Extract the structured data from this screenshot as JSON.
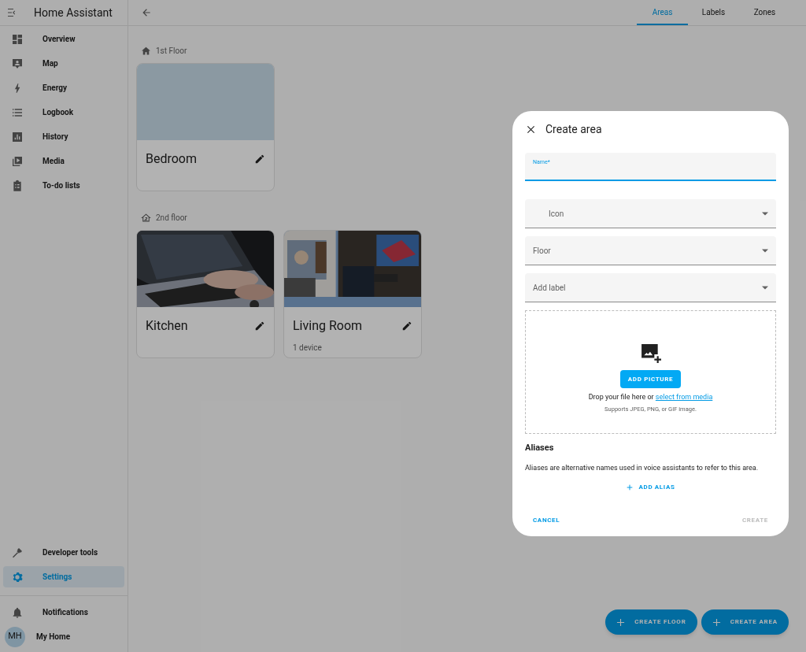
{
  "sidebar": {
    "title": "Home Assistant",
    "items": [
      {
        "label": "Overview",
        "kind": "dashboard",
        "selected": false
      },
      {
        "label": "Map",
        "kind": "map",
        "selected": false
      },
      {
        "label": "Energy",
        "kind": "bolt",
        "selected": false
      },
      {
        "label": "Logbook",
        "kind": "list",
        "selected": false
      },
      {
        "label": "History",
        "kind": "chart",
        "selected": false
      },
      {
        "label": "Media",
        "kind": "play",
        "selected": false
      },
      {
        "label": "To-do lists",
        "kind": "clipboard",
        "selected": false
      }
    ],
    "bottom_items": [
      {
        "label": "Developer tools",
        "kind": "hammer",
        "selected": false
      },
      {
        "label": "Settings",
        "kind": "gear",
        "selected": true
      }
    ],
    "notifications": "Notifications",
    "user": {
      "initials": "MH",
      "name": "My Home"
    }
  },
  "tabs": [
    {
      "label": "Areas",
      "selected": true
    },
    {
      "label": "Labels",
      "selected": false
    },
    {
      "label": "Zones",
      "selected": false
    }
  ],
  "floors": [
    {
      "name": "1st Floor",
      "kind": "floor1",
      "areas": [
        {
          "name": "Bedroom",
          "kind": "blank"
        }
      ]
    },
    {
      "name": "2nd floor",
      "kind": "floor2",
      "areas": [
        {
          "name": "Kitchen",
          "kind": "laptop"
        },
        {
          "name": "Living Room",
          "kind": "livingroom",
          "subtitle": "1 device"
        }
      ]
    }
  ],
  "fab_buttons": [
    "CREATE FLOOR",
    "CREATE AREA"
  ],
  "dialog": {
    "title": "Create area",
    "name_field": {
      "label": "Name*"
    },
    "selects": [
      {
        "placeholder": "Icon",
        "kind": "icon"
      },
      {
        "placeholder": "Floor",
        "kind": "plain"
      },
      {
        "placeholder": "Add label",
        "kind": "plain"
      }
    ],
    "upload": {
      "button": "ADD PICTURE",
      "text": "Drop your file here or ",
      "link": "select from media",
      "hint": "Supports JPEG, PNG, or GIF image."
    },
    "aliases": {
      "heading": "Aliases",
      "description": "Aliases are alternative names used in voice assistants to refer to this area.",
      "add": "ADD ALIAS"
    },
    "cancel": "CANCEL",
    "create": {
      "label": "CREATE",
      "disabled": true
    }
  }
}
